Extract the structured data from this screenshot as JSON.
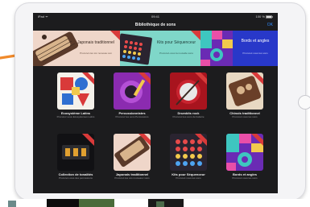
{
  "status_bar": {
    "left": "iPad ᯤ",
    "time": "09:41",
    "right": "100 %"
  },
  "nav": {
    "title": "Bibliothèque de sons",
    "done_label": "OK"
  },
  "banner": [
    {
      "title": "Japonais traditionnel",
      "subtitle": "Procurez-les ton nouveau son"
    },
    {
      "title": "Kits pour Séquenceur",
      "subtitle": "Procurez-vous la nouvelle sons"
    },
    {
      "title": "",
      "subtitle": ""
    },
    {
      "title": "Bords et angles",
      "subtitle": "Procurez-vous les sons"
    }
  ],
  "tiles": [
    {
      "name": "Ecosystème Latins",
      "subtitle": "Procurez-vous Ecosystèmes Latins"
    },
    {
      "name": "Percussionnistes",
      "subtitle": "Procurez les sons Percussions"
    },
    {
      "name": "Drumkits rock",
      "subtitle": "Procurez-les sons de batterie"
    },
    {
      "name": "Chinois traditionnel",
      "subtitle": "Procurez-vous les sons"
    },
    {
      "name": "Collection de tonalités",
      "subtitle": "Procurez-vous des percussions"
    },
    {
      "name": "Japonais traditionnel",
      "subtitle": "Procurez-les vos nouveaux sons"
    },
    {
      "name": "Kits pour Séquenceur",
      "subtitle": "Procurez-vous les sons"
    },
    {
      "name": "Bords et angles",
      "subtitle": "Procurez-vous les sons"
    }
  ],
  "colors": {
    "accent": "#2f8cff",
    "arrow": "#f08a2b",
    "ribbon": "#d93a3a"
  },
  "icons": [
    "wifi-icon",
    "battery-icon",
    "arrow-pointer-icon",
    "home-button-icon"
  ]
}
